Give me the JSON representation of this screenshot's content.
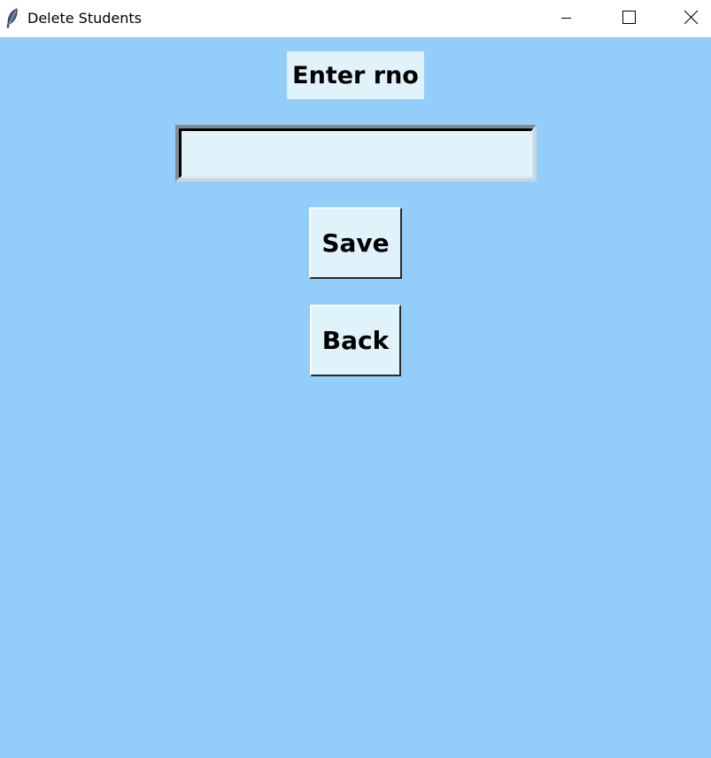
{
  "window": {
    "title": "Delete Students",
    "icon": "feather-icon",
    "background_color": "#93cdf9"
  },
  "titlebar_controls": {
    "minimize_icon": "minimize-icon",
    "maximize_icon": "maximize-icon",
    "close_icon": "close-icon"
  },
  "form": {
    "label": "Enter rno",
    "rno_value": "",
    "save_label": "Save",
    "back_label": "Back",
    "widget_color": "#e1f3fa"
  }
}
